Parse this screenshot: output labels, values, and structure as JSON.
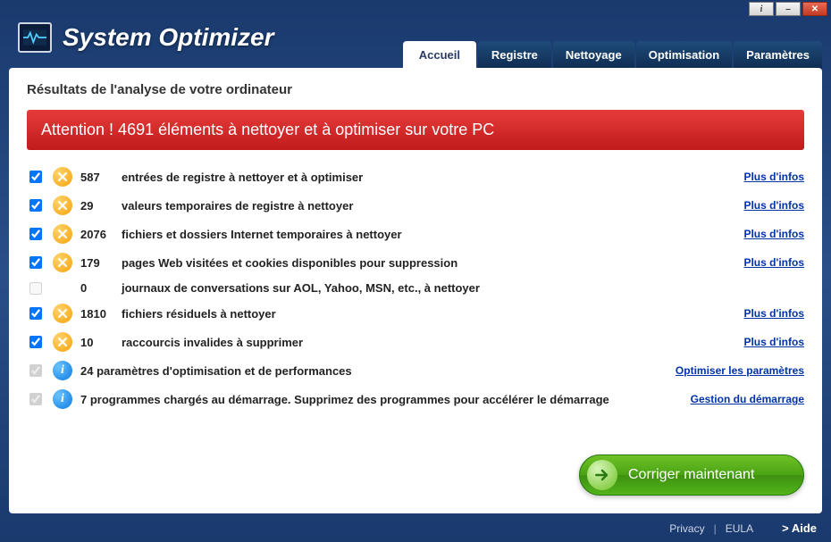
{
  "app": {
    "title": "System Optimizer"
  },
  "window_controls": {
    "info": "i",
    "minimize": "–",
    "close": "✕"
  },
  "tabs": [
    {
      "label": "Accueil",
      "active": true
    },
    {
      "label": "Registre",
      "active": false
    },
    {
      "label": "Nettoyage",
      "active": false
    },
    {
      "label": "Optimisation",
      "active": false
    },
    {
      "label": "Paramètres",
      "active": false
    }
  ],
  "panel": {
    "heading": "Résultats de l'analyse de votre ordinateur",
    "alert": "Attention ! 4691 éléments à nettoyer et à optimiser sur votre PC"
  },
  "rows": [
    {
      "checked": true,
      "enabled": true,
      "icon": "warn",
      "count": "587",
      "label": "entrées de registre à nettoyer et à optimiser",
      "link": "Plus d'infos"
    },
    {
      "checked": true,
      "enabled": true,
      "icon": "warn",
      "count": "29",
      "label": "valeurs temporaires de registre à nettoyer",
      "link": "Plus d'infos"
    },
    {
      "checked": true,
      "enabled": true,
      "icon": "warn",
      "count": "2076",
      "label": "fichiers et dossiers Internet temporaires à nettoyer",
      "link": "Plus d'infos"
    },
    {
      "checked": true,
      "enabled": true,
      "icon": "warn",
      "count": "179",
      "label": "pages Web visitées et cookies disponibles pour suppression",
      "link": "Plus d'infos"
    },
    {
      "checked": false,
      "enabled": false,
      "icon": "",
      "count": "0",
      "label": "journaux de conversations sur AOL, Yahoo, MSN, etc., à nettoyer",
      "link": ""
    },
    {
      "checked": true,
      "enabled": true,
      "icon": "warn",
      "count": "1810",
      "label": "fichiers résiduels à nettoyer",
      "link": "Plus d'infos"
    },
    {
      "checked": true,
      "enabled": true,
      "icon": "warn",
      "count": "10",
      "label": "raccourcis invalides à supprimer",
      "link": "Plus d'infos"
    },
    {
      "checked": true,
      "enabled": false,
      "icon": "info",
      "fulltext": "24 paramètres d'optimisation et de performances",
      "link": "Optimiser les paramètres"
    },
    {
      "checked": true,
      "enabled": false,
      "icon": "info",
      "fulltext": "7 programmes chargés au démarrage. Supprimez des programmes pour accélérer le démarrage",
      "link": "Gestion du démarrage"
    }
  ],
  "fix_button": "Corriger maintenant",
  "footer": {
    "privacy": "Privacy",
    "eula": "EULA",
    "help": "> Aide"
  }
}
